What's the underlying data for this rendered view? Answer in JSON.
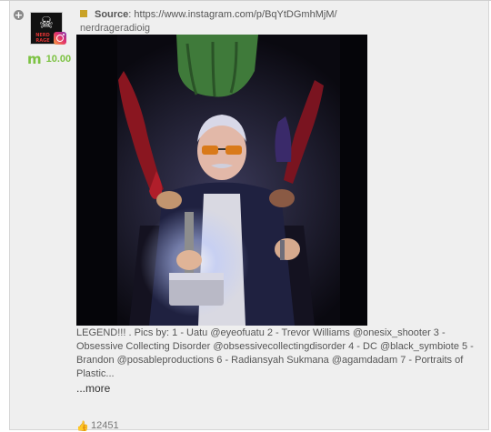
{
  "post": {
    "score": "10.00",
    "source_label": "Source",
    "source_url": "https://www.instagram.com/p/BqYtDGmhMjM/",
    "handle": "nerdrageradioig",
    "caption": "LEGEND!!! . Pics by: 1 - Uatu @eyeofuatu 2 - Trevor Williams @onesix_shooter 3 - Obsessive Collecting Disorder @obsessivecollectingdisorder 4 - DC @black_symbiote 5 - Brandon @posableproductions 6 - Radiansyah Sukmana @agamdadam 7 - Portraits of Plastic...",
    "more_label": "...more",
    "likes": "12451",
    "corner_char": "¸"
  },
  "avatar": {
    "text": "NERD RAGE"
  },
  "icons": {
    "expand": "plus-circle-icon",
    "instagram": "instagram-icon",
    "score": "m-score-icon",
    "source": "source-square-icon",
    "likes": "thumbs-up-icon"
  },
  "colors": {
    "score_green": "#7cc242",
    "source_square": "#c9a227",
    "card_bg": "#efefef"
  }
}
